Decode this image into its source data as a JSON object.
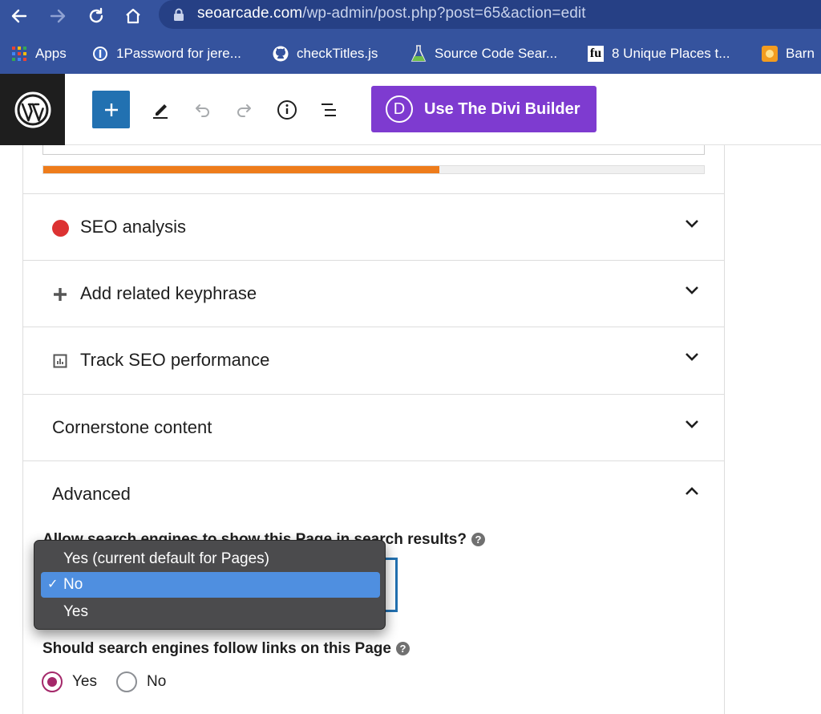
{
  "browser": {
    "url_host": "seoarcade.com",
    "url_path": "/wp-admin/post.php?post=65&action=edit",
    "bookmarks": [
      {
        "label": "Apps",
        "icon": "apps-grid-icon"
      },
      {
        "label": "1Password for jere...",
        "icon": "onepassword-icon"
      },
      {
        "label": "checkTitles.js",
        "icon": "github-icon"
      },
      {
        "label": "Source Code Sear...",
        "icon": "flask-icon"
      },
      {
        "label": "8 Unique Places t...",
        "icon": "fu-icon"
      },
      {
        "label": "Barn",
        "icon": "barn-icon"
      }
    ]
  },
  "toolbar": {
    "divi_label": "Use The Divi Builder",
    "divi_letter": "D"
  },
  "seo_panel": {
    "progress_fraction": 0.6,
    "sections": [
      {
        "label": "SEO analysis",
        "icon": "red-dot-icon",
        "state": "collapsed"
      },
      {
        "label": "Add related keyphrase",
        "icon": "plus-icon",
        "state": "collapsed"
      },
      {
        "label": "Track SEO performance",
        "icon": "chart-icon",
        "state": "collapsed"
      },
      {
        "label": "Cornerstone content",
        "icon": "",
        "state": "collapsed"
      },
      {
        "label": "Advanced",
        "icon": "",
        "state": "expanded"
      }
    ],
    "advanced": {
      "question_index": "Allow search engines to show this Page in search results?",
      "help_glyph": "?",
      "dropdown_options": [
        "Yes (current default for Pages)",
        "No",
        "Yes"
      ],
      "dropdown_selected": "No",
      "check_glyph": "✓",
      "question_follow": "Should search engines follow links on this Page",
      "radio_options": [
        "Yes",
        "No"
      ],
      "radio_selected": "Yes"
    }
  },
  "colors": {
    "browser_bar": "#35539e",
    "divi_purple": "#7e3bd0",
    "wp_blue": "#2271b1",
    "progress_orange": "#ee7c1b",
    "seo_red": "#dc3232",
    "dropdown_highlight": "#4f8fe0",
    "radio_selected": "#a4286a"
  }
}
